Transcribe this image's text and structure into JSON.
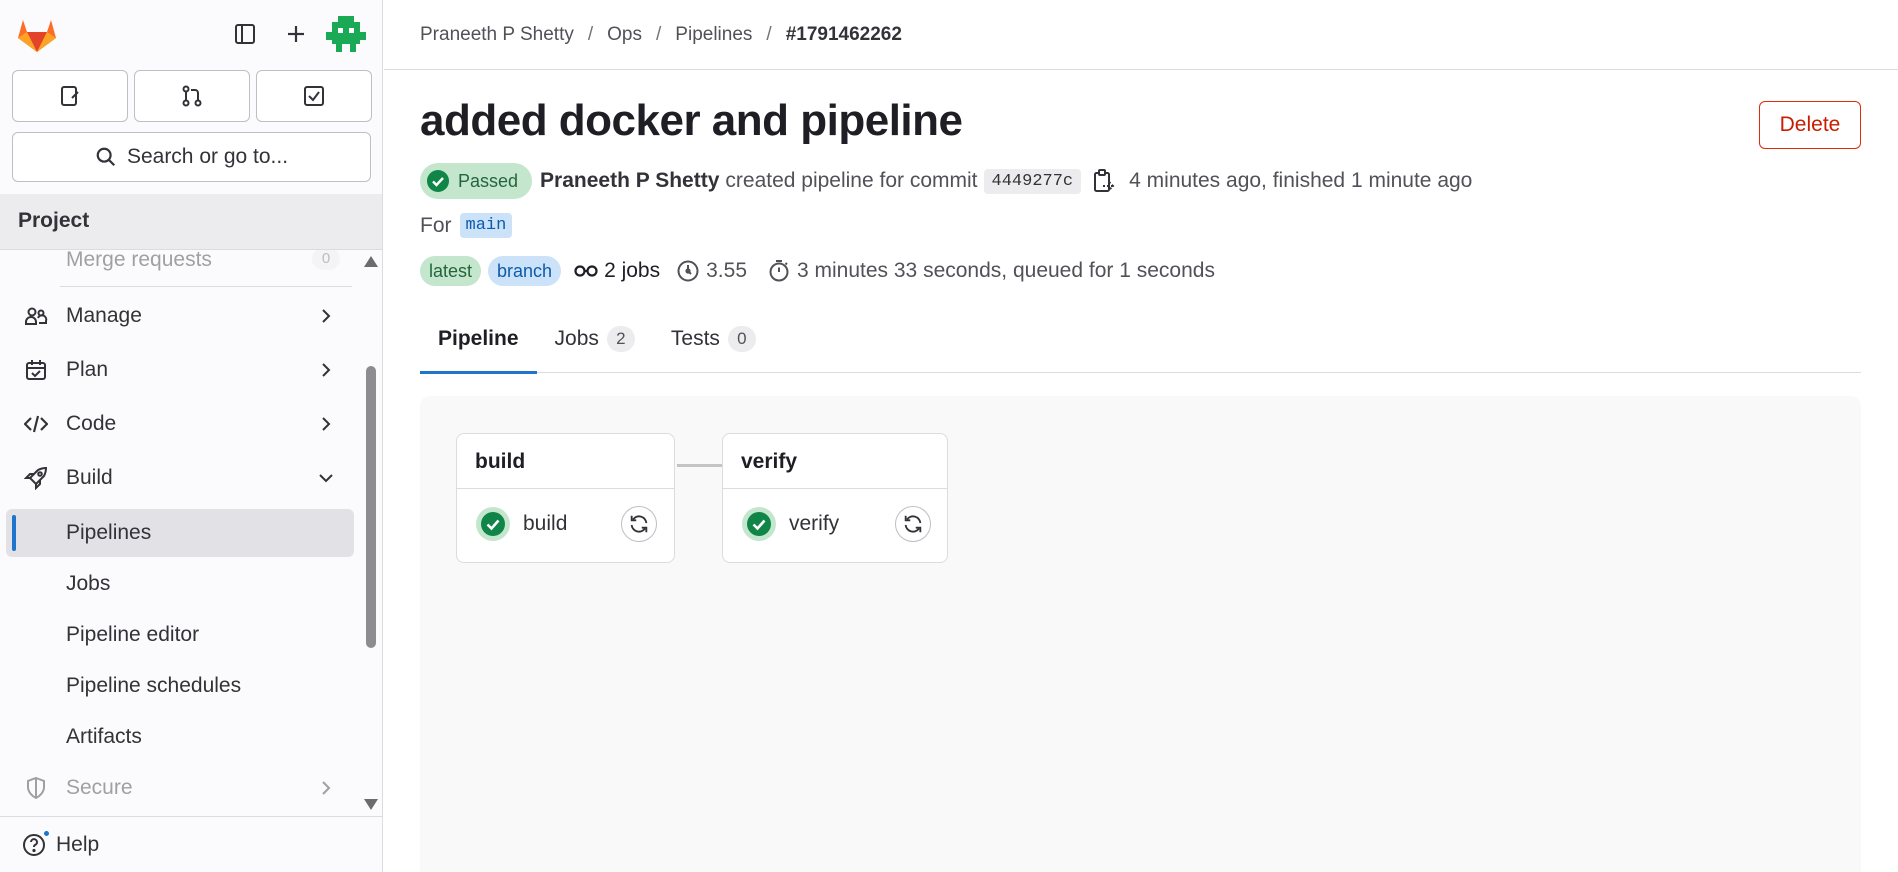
{
  "sidebar": {
    "search_label": "Search or go to...",
    "section_title": "Project",
    "items": [
      {
        "label": "Merge requests",
        "count": "0"
      },
      {
        "label": "Manage"
      },
      {
        "label": "Plan"
      },
      {
        "label": "Code"
      },
      {
        "label": "Build"
      },
      {
        "label": "Pipelines"
      },
      {
        "label": "Jobs"
      },
      {
        "label": "Pipeline editor"
      },
      {
        "label": "Pipeline schedules"
      },
      {
        "label": "Artifacts"
      },
      {
        "label": "Secure"
      }
    ],
    "help_label": "Help"
  },
  "breadcrumb": {
    "items": [
      "Praneeth P Shetty",
      "Ops",
      "Pipelines",
      "#1791462262"
    ],
    "separator": "/"
  },
  "page": {
    "title": "added docker and pipeline",
    "delete_label": "Delete",
    "status": "Passed",
    "author": "Praneeth P Shetty",
    "created_text": "created pipeline for commit",
    "commit_sha": "4449277c",
    "time_text": "4 minutes ago, finished 1 minute ago",
    "for_label": "For",
    "branch": "main",
    "tag_latest": "latest",
    "tag_branch": "branch",
    "jobs_count_text": "2 jobs",
    "compute": "3.55",
    "duration_text": "3 minutes 33 seconds, queued for 1 seconds"
  },
  "tabs": [
    {
      "label": "Pipeline"
    },
    {
      "label": "Jobs",
      "count": "2"
    },
    {
      "label": "Tests",
      "count": "0"
    }
  ],
  "stages": [
    {
      "title": "build",
      "job": "build"
    },
    {
      "title": "verify",
      "job": "verify"
    }
  ],
  "colors": {
    "accent": "#1f75cb",
    "success": "#108548",
    "danger": "#dd2b0e",
    "brand_orange": "#e24329"
  }
}
